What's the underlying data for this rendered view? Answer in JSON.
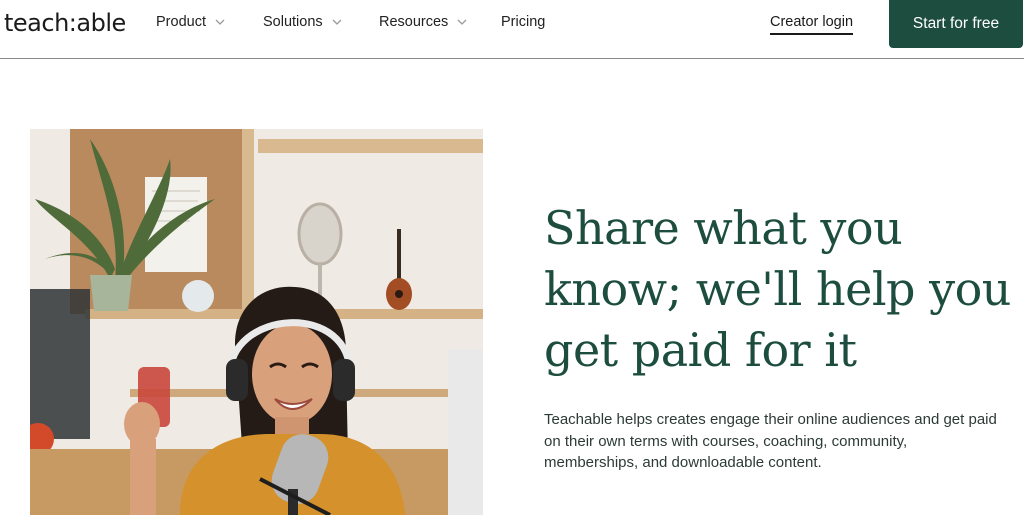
{
  "header": {
    "logo": "teach:able",
    "nav": [
      {
        "label": "Product",
        "has_dropdown": true
      },
      {
        "label": "Solutions",
        "has_dropdown": true
      },
      {
        "label": "Resources",
        "has_dropdown": true
      },
      {
        "label": "Pricing",
        "has_dropdown": false
      }
    ],
    "creator_login": "Creator login",
    "cta": "Start for free"
  },
  "hero": {
    "headline": "Share what you know; we'll help you get paid for it",
    "subtext": "Teachable helps creates engage their online audiences and get paid on their own terms with courses, coaching, community, memberships, and downloadable content.",
    "image": "woman-with-headphones-podcasting-photo"
  },
  "colors": {
    "brand_green": "#1d4d3f",
    "cta_text": "#ffffff"
  }
}
